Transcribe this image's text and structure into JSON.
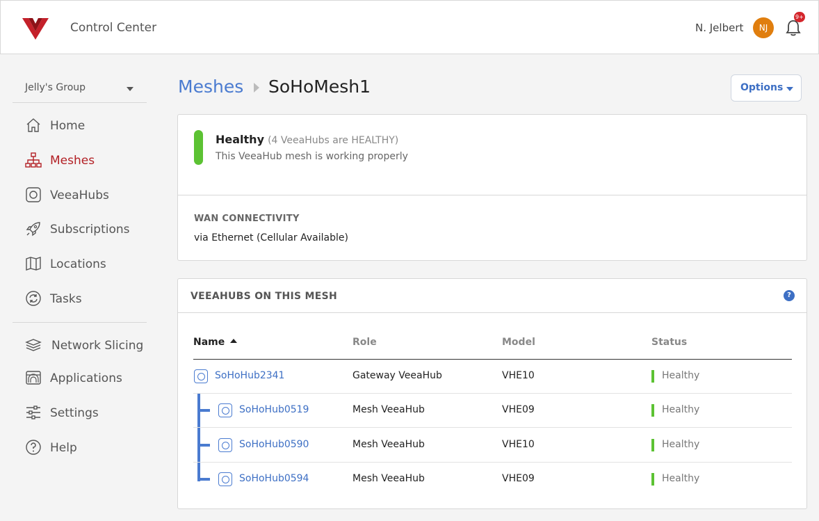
{
  "header": {
    "app_title": "Control Center",
    "user_name": "N. Jelbert",
    "avatar_initials": "NJ",
    "notification_badge": "9+"
  },
  "sidebar": {
    "group": "Jelly's Group",
    "items": [
      {
        "label": "Home",
        "icon": "home-icon"
      },
      {
        "label": "Meshes",
        "icon": "mesh-icon",
        "active": true
      },
      {
        "label": "VeeaHubs",
        "icon": "veeahub-icon"
      },
      {
        "label": "Subscriptions",
        "icon": "rocket-icon"
      },
      {
        "label": "Locations",
        "icon": "map-icon"
      },
      {
        "label": "Tasks",
        "icon": "refresh-icon"
      },
      {
        "label": "Network Slicing",
        "icon": "layers-icon"
      },
      {
        "label": "Applications",
        "icon": "applications-icon"
      },
      {
        "label": "Settings",
        "icon": "sliders-icon"
      },
      {
        "label": "Help",
        "icon": "help-icon"
      }
    ]
  },
  "breadcrumb": {
    "parent": "Meshes",
    "current": "SoHoMesh1"
  },
  "options_button": "Options",
  "health": {
    "status": "Healthy",
    "detail": "(4 VeeaHubs are HEALTHY)",
    "description": "This VeeaHub mesh is working properly",
    "color": "#5cc233"
  },
  "wan": {
    "label": "WAN CONNECTIVITY",
    "value": "via Ethernet (Cellular Available)"
  },
  "hubs": {
    "title": "VEEAHUBS ON THIS MESH",
    "help": "?",
    "columns": [
      "Name",
      "Role",
      "Model",
      "Status"
    ],
    "rows": [
      {
        "name": "SoHoHub2341",
        "role": "Gateway VeeaHub",
        "model": "VHE10",
        "status": "Healthy"
      },
      {
        "name": "SoHoHub0519",
        "role": "Mesh VeeaHub",
        "model": "VHE09",
        "status": "Healthy"
      },
      {
        "name": "SoHoHub0590",
        "role": "Mesh VeeaHub",
        "model": "VHE10",
        "status": "Healthy"
      },
      {
        "name": "SoHoHub0594",
        "role": "Mesh VeeaHub",
        "model": "VHE09",
        "status": "Healthy"
      }
    ]
  },
  "colors": {
    "brand": "#b21f24",
    "link": "#3d6fc4",
    "healthy": "#5cc233"
  }
}
